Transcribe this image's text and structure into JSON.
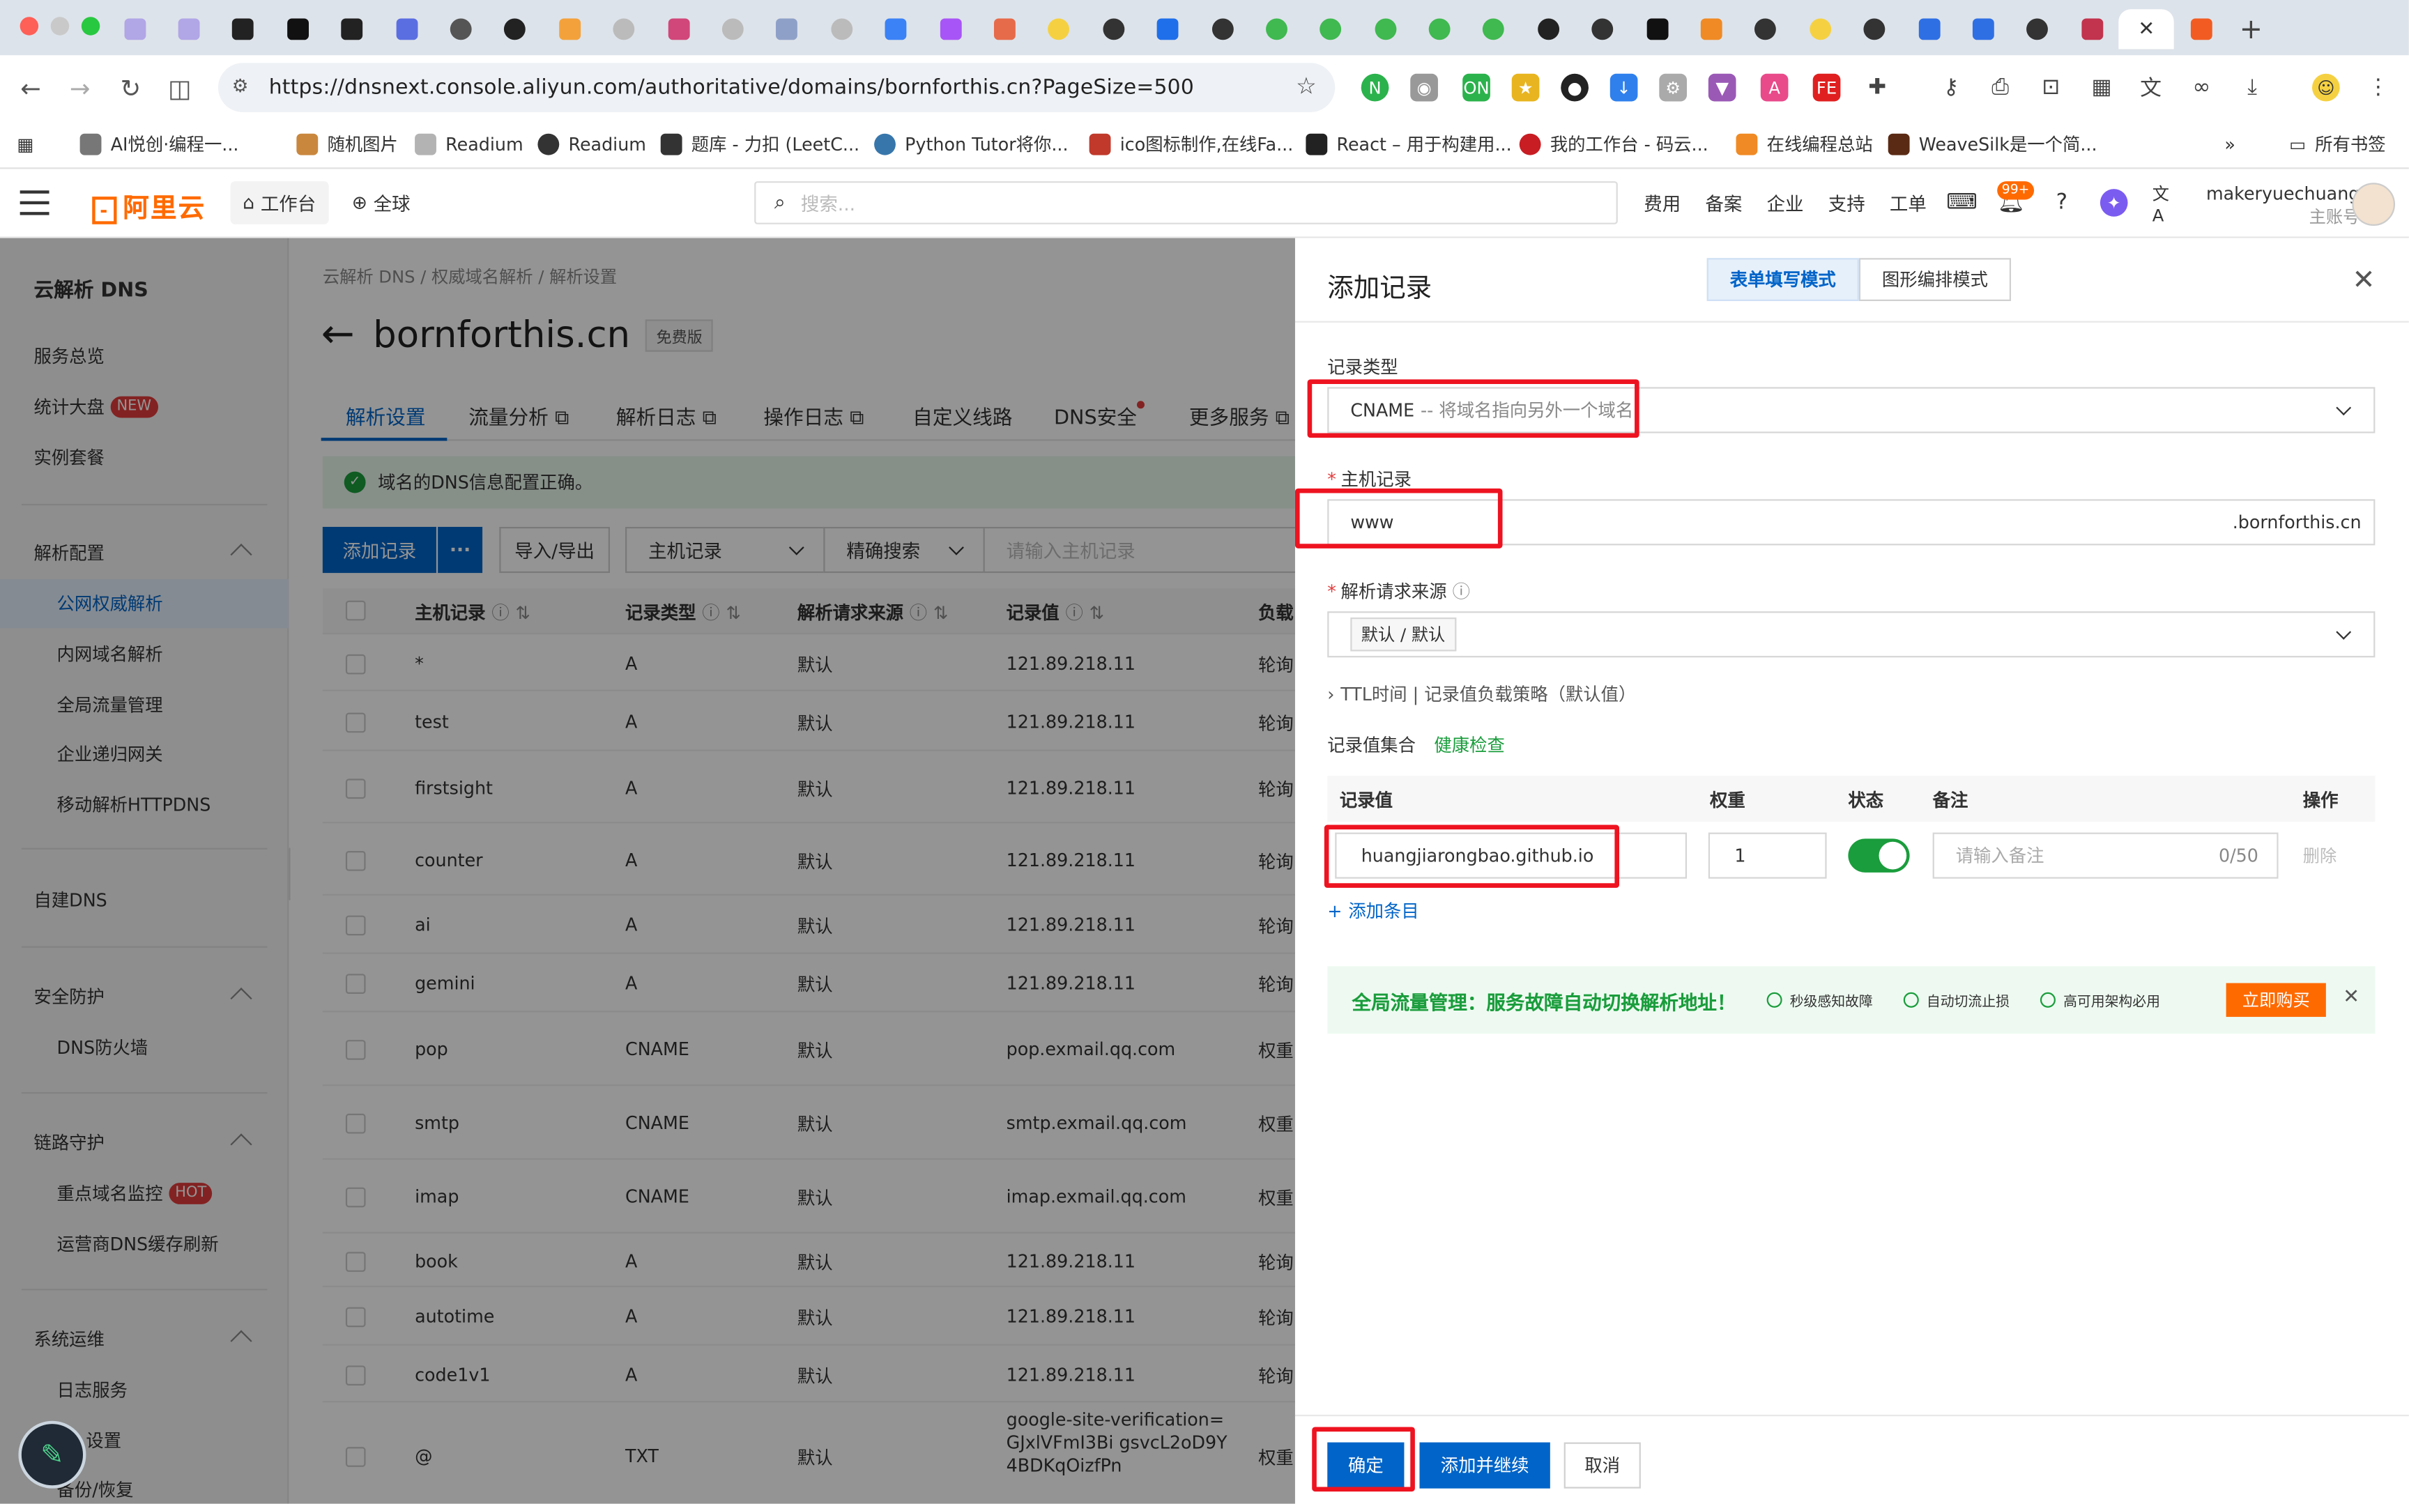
{
  "browser": {
    "url": "https://dnsnext.console.aliyun.com/authoritative/domains/bornforthis.cn?PageSize=500",
    "bookmarks": [
      "AI悦创·编程一...",
      "随机图片",
      "Readium",
      "Readium",
      "题库 - 力扣 (LeetC...",
      "Python Tutor将你...",
      "ico图标制作,在线Fa...",
      "React – 用于构建用...",
      "我的工作台 - 码云...",
      "在线编程总站",
      "WeaveSilk是一个简..."
    ],
    "all_bookmarks": "所有书签"
  },
  "header": {
    "logo": "阿里云",
    "workbench": "工作台",
    "region": "全球",
    "search_placeholder": "搜索...",
    "links": [
      "费用",
      "备案",
      "企业",
      "支持",
      "工单"
    ],
    "notif_count": "99+",
    "username": "makeryuechuang",
    "account_type": "主账号"
  },
  "sidebar": {
    "title": "云解析 DNS",
    "overview": "服务总览",
    "dashboard": "统计大盘",
    "new_badge": "NEW",
    "instance": "实例套餐",
    "group_resolve": "解析配置",
    "public": "公网权威解析",
    "internal": "内网域名解析",
    "traffic": "全局流量管理",
    "recursion": "企业递归网关",
    "httpdns": "移动解析HTTPDNS",
    "selfdns": "自建DNS",
    "group_security": "安全防护",
    "firewall": "DNS防火墙",
    "group_link": "链路守护",
    "monitor": "重点域名监控",
    "hot_badge": "HOT",
    "cache": "运营商DNS缓存刷新",
    "group_ops": "系统运维",
    "logs": "日志服务",
    "settings": "设置",
    "backup": "备份/恢复"
  },
  "main": {
    "breadcrumb": "云解析 DNS  /  权威域名解析  /  解析设置",
    "domain": "bornforthis.cn",
    "edition": "免费版",
    "tabs": [
      "解析设置",
      "流量分析",
      "解析日志",
      "操作日志",
      "自定义线路",
      "DNS安全",
      "更多服务"
    ],
    "alert": "域名的DNS信息配置正确。",
    "add_record": "添加记录",
    "more": "···",
    "import_export": "导入/导出",
    "filter_field": "主机记录",
    "filter_mode": "精确搜索",
    "filter_placeholder": "请输入主机记录",
    "columns": [
      "主机记录",
      "记录类型",
      "解析请求来源",
      "记录值",
      "负载"
    ],
    "rows": [
      {
        "host": "*",
        "type": "A",
        "line": "默认",
        "value": "121.89.218.11",
        "lb": "轮询"
      },
      {
        "host": "test",
        "type": "A",
        "line": "默认",
        "value": "121.89.218.11",
        "lb": "轮询"
      },
      {
        "host": "firstsight",
        "type": "A",
        "line": "默认",
        "value": "121.89.218.11",
        "lb": "轮询"
      },
      {
        "host": "counter",
        "type": "A",
        "line": "默认",
        "value": "121.89.218.11",
        "lb": "轮询"
      },
      {
        "host": "ai",
        "type": "A",
        "line": "默认",
        "value": "121.89.218.11",
        "lb": "轮询"
      },
      {
        "host": "gemini",
        "type": "A",
        "line": "默认",
        "value": "121.89.218.11",
        "lb": "轮询"
      },
      {
        "host": "pop",
        "type": "CNAME",
        "line": "默认",
        "value": "pop.exmail.qq.com",
        "lb": "权重"
      },
      {
        "host": "smtp",
        "type": "CNAME",
        "line": "默认",
        "value": "smtp.exmail.qq.com",
        "lb": "权重"
      },
      {
        "host": "imap",
        "type": "CNAME",
        "line": "默认",
        "value": "imap.exmail.qq.com",
        "lb": "权重"
      },
      {
        "host": "book",
        "type": "A",
        "line": "默认",
        "value": "121.89.218.11",
        "lb": "轮询"
      },
      {
        "host": "autotime",
        "type": "A",
        "line": "默认",
        "value": "121.89.218.11",
        "lb": "轮询"
      },
      {
        "host": "code1v1",
        "type": "A",
        "line": "默认",
        "value": "121.89.218.11",
        "lb": "轮询"
      },
      {
        "host": "@",
        "type": "TXT",
        "line": "默认",
        "value": "google-site-verification=GJxlVFmI3Bi gsvcL2oD9Y4BDKqOizfPn",
        "lb": "权重"
      }
    ]
  },
  "drawer": {
    "title": "添加记录",
    "mode_form": "表单填写模式",
    "mode_graph": "图形编排模式",
    "type_label": "记录类型",
    "type_value": "CNAME",
    "type_desc": "-- 将域名指向另外一个域名",
    "host_label": "主机记录",
    "host_value": "www",
    "host_suffix": ".bornforthis.cn",
    "line_label": "解析请求来源",
    "line_value": "默认 / 默认",
    "advanced": "TTL时间 | 记录值负载策略（默认值）",
    "set_label": "记录值集合",
    "health": "健康检查",
    "cols": [
      "记录值",
      "权重",
      "状态",
      "备注",
      "操作"
    ],
    "record_value": "huangjiarongbao.github.io",
    "weight": "1",
    "remark_placeholder": "请输入备注",
    "remark_count": "0/50",
    "delete": "删除",
    "add_item": "添加条目",
    "promo_title": "全局流量管理：服务故障自动切换解析地址！",
    "promo_points": [
      "秒级感知故障",
      "自动切流止损",
      "高可用架构必用"
    ],
    "promo_buy": "立即购买",
    "ok": "确定",
    "ok_continue": "添加并继续",
    "cancel": "取消"
  }
}
